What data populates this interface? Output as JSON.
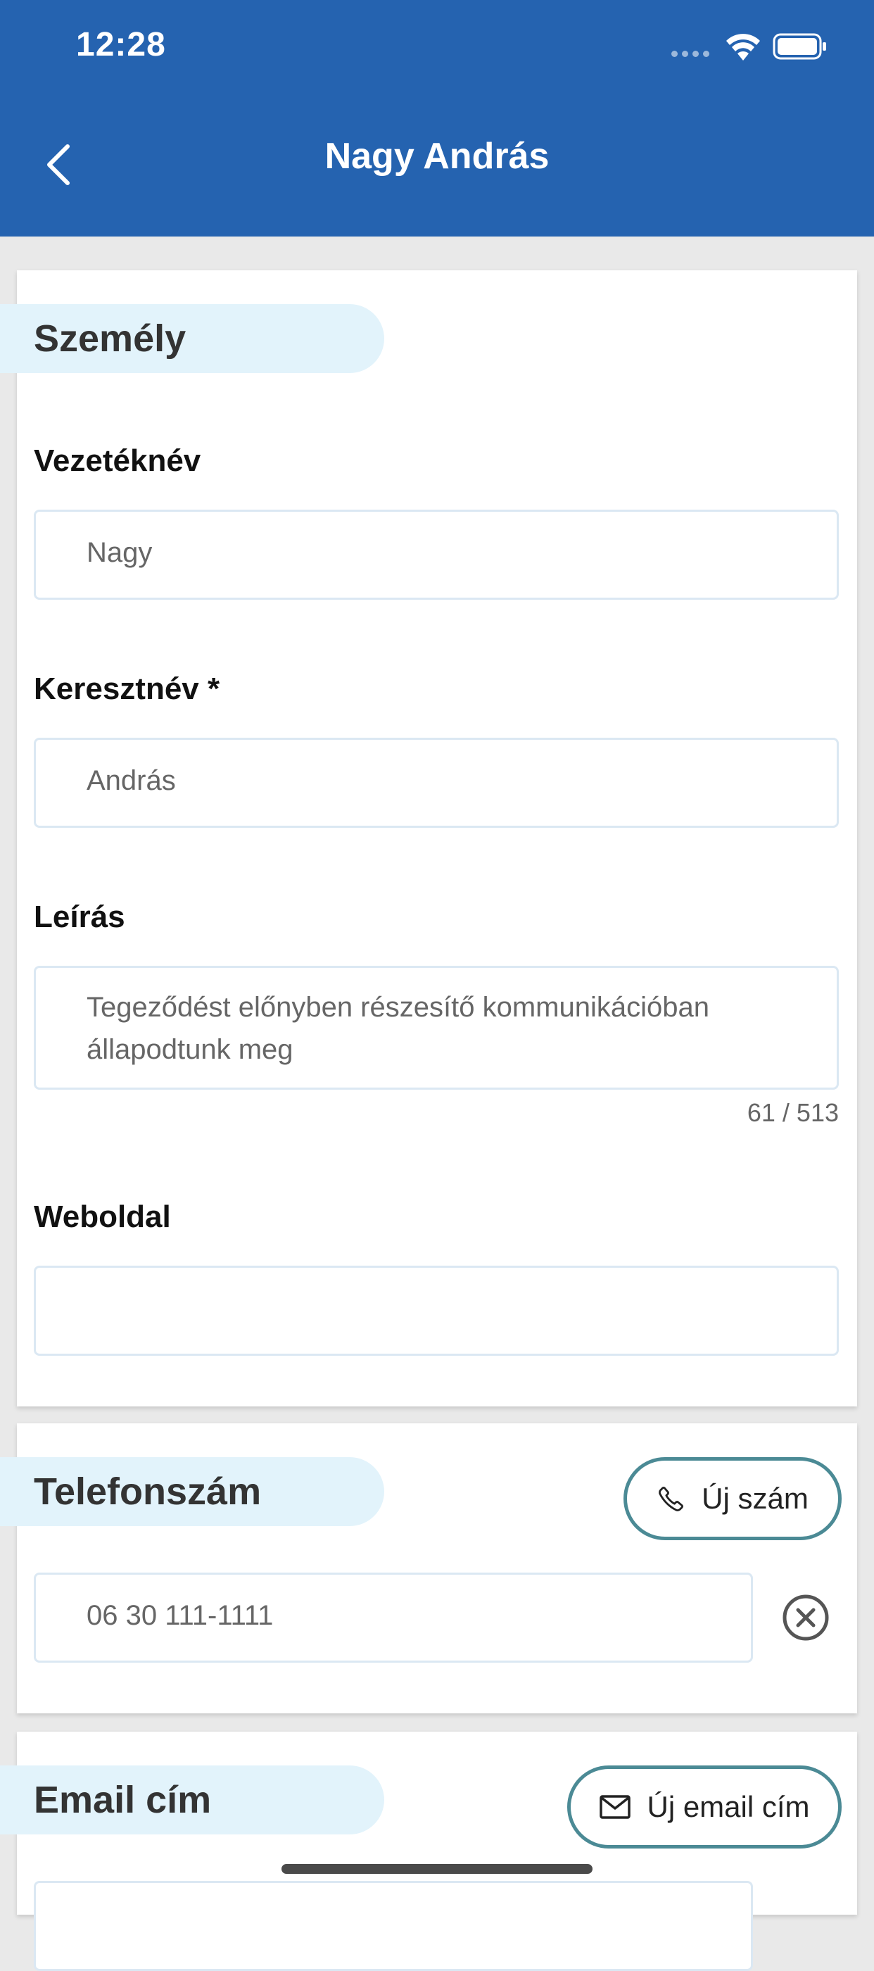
{
  "status_bar": {
    "time": "12:28"
  },
  "nav": {
    "title": "Nagy András"
  },
  "person_section": {
    "title": "Személy",
    "last_name": {
      "label": "Vezetéknév",
      "value": "Nagy"
    },
    "first_name": {
      "label": "Keresztnév *",
      "value": "András"
    },
    "description": {
      "label": "Leírás",
      "value": "Tegeződést előnyben részesítő kommunikációban állapodtunk meg",
      "counter": "61 / 513"
    },
    "website": {
      "label": "Weboldal",
      "value": ""
    }
  },
  "phone_section": {
    "title": "Telefonszám",
    "add_label": "Új szám",
    "phone_value": "06 30 111-1111"
  },
  "email_section": {
    "title": "Email cím",
    "add_label": "Új email cím"
  },
  "icons": {
    "back": "chevron-left-icon",
    "phone": "phone-icon",
    "email": "mail-icon",
    "clear": "close-circle-icon"
  },
  "colors": {
    "primary": "#2563b0",
    "section_pill": "#e2f3fb",
    "button_border": "#4b8a95"
  }
}
